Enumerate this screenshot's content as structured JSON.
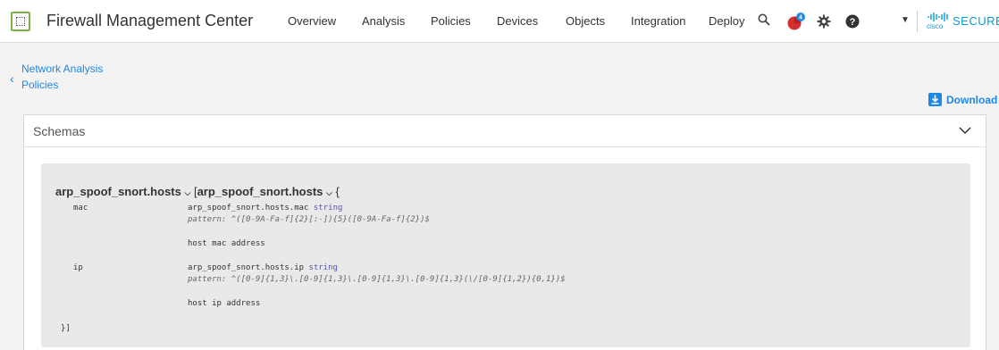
{
  "header": {
    "app_title": "Firewall Management Center",
    "nav": [
      "Overview",
      "Analysis",
      "Policies",
      "Devices",
      "Objects",
      "Integration",
      "Deploy"
    ],
    "alert_count": "4",
    "cisco_word": "cisco",
    "cisco_product": "SECURE",
    "colors": {
      "accent": "#1e88e5",
      "logo_green": "#7cb342",
      "alert_red": "#d32f2f",
      "cisco_blue": "#049fd9"
    },
    "icons": [
      "search-icon",
      "alert-icon",
      "gear-icon",
      "help-icon"
    ]
  },
  "breadcrumb": {
    "line1": "Network Analysis",
    "line2": "Policies"
  },
  "download": {
    "label": "Download"
  },
  "schemas": {
    "title": "Schemas",
    "model": {
      "name": "arp_spoof_snort.hosts",
      "open_bracket": "[",
      "inner_name": "arp_spoof_snort.hosts",
      "open_brace": "{",
      "close": "}]",
      "properties": [
        {
          "name": "mac",
          "qualified": "arp_spoof_snort.hosts.mac",
          "type": "string",
          "pattern": "pattern: ^([0-9A-Fa-f]{2}[:-]){5}([0-9A-Fa-f]{2})$",
          "description": "host mac address"
        },
        {
          "name": "ip",
          "qualified": "arp_spoof_snort.hosts.ip",
          "type": "string",
          "pattern": "pattern: ^([0-9]{1,3}\\.[0-9]{1,3}\\.[0-9]{1,3}\\.[0-9]{1,3}(\\/[0-9]{1,2}){0,1})$",
          "description": "host ip address"
        }
      ]
    }
  }
}
